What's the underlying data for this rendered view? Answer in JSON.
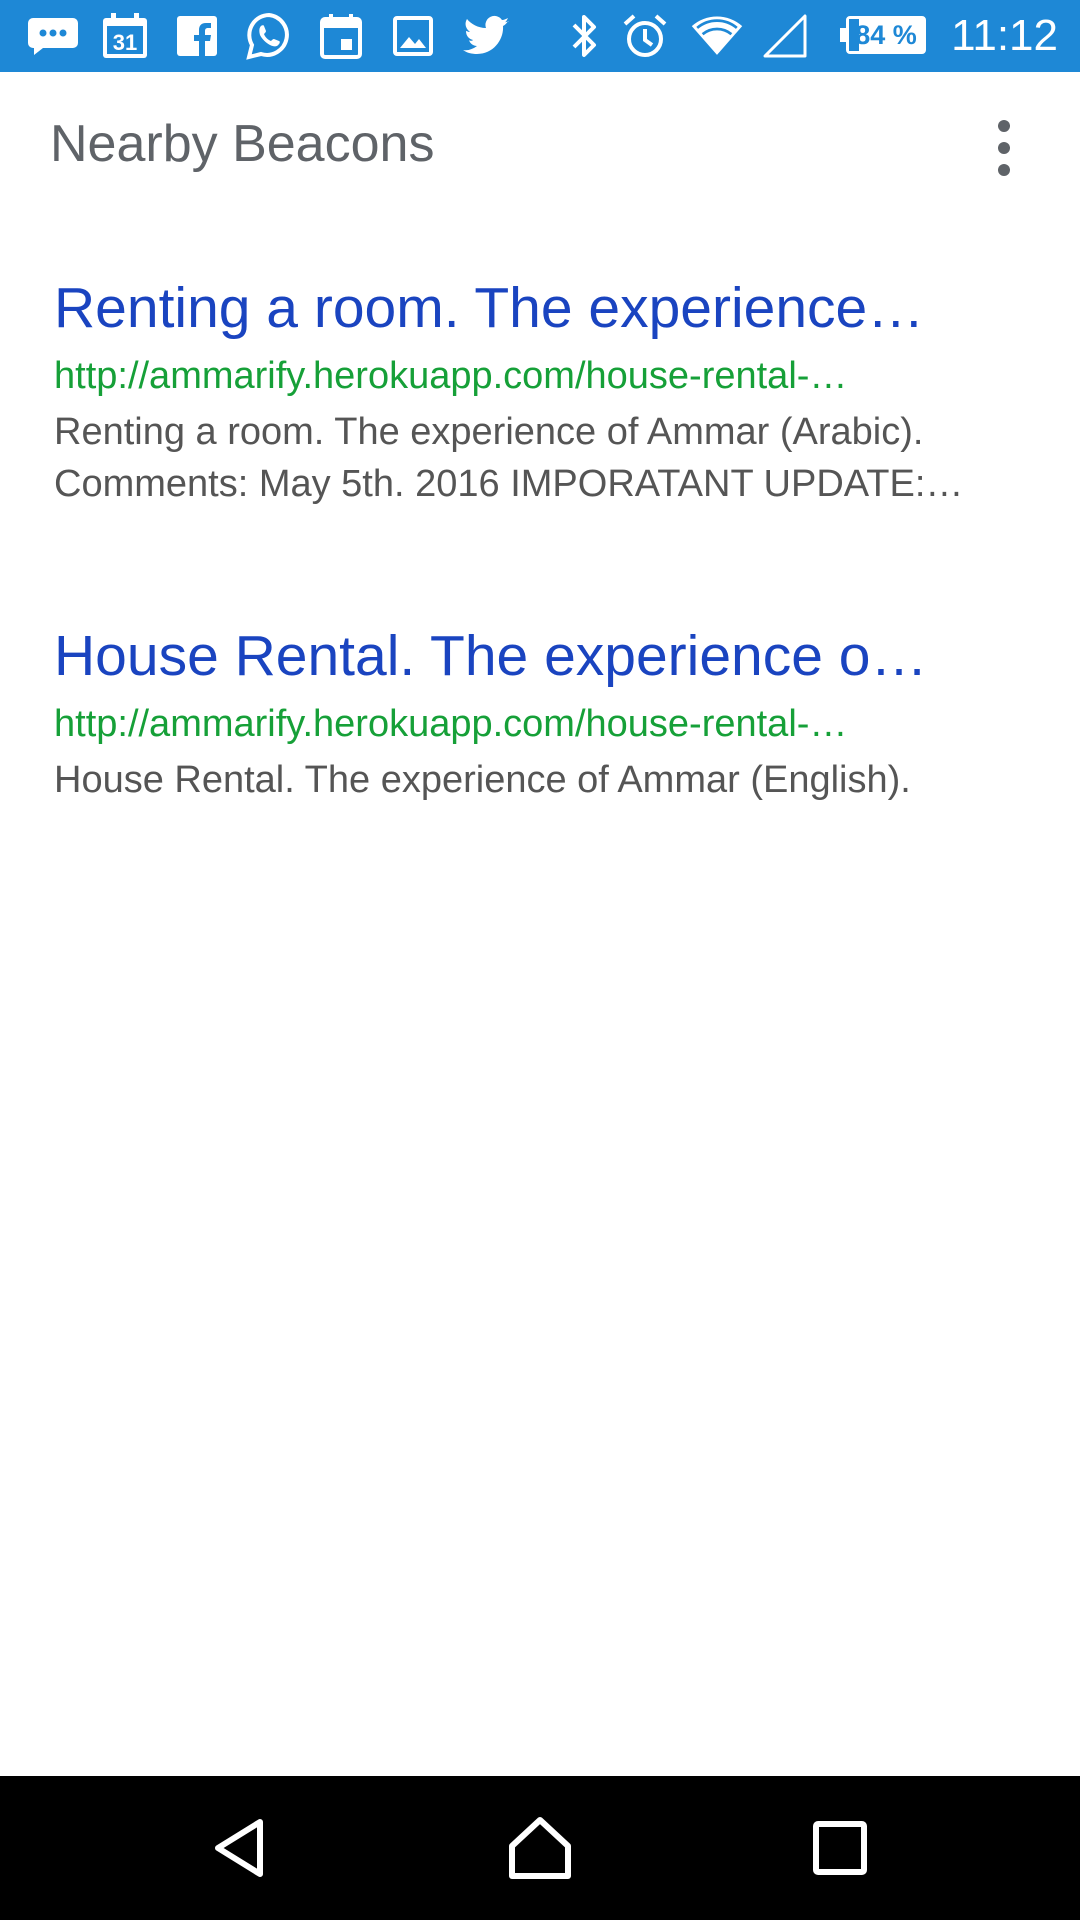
{
  "status_bar": {
    "notification_icons": [
      "chat-bubble-icon",
      "calendar-31-icon",
      "facebook-icon",
      "whatsapp-icon",
      "calendar-icon",
      "image-icon",
      "twitter-icon"
    ],
    "calendar_day": "31",
    "system_icons": [
      "bluetooth-icon",
      "alarm-icon",
      "wifi-icon",
      "cell-signal-icon"
    ],
    "battery": "84 %",
    "battery_level_percent": 84,
    "time": "11:12",
    "background_color": "#1e88d6"
  },
  "app_bar": {
    "title": "Nearby Beacons",
    "menu_icon": "more-vert-icon"
  },
  "results": [
    {
      "title": "Renting a room. The experience…",
      "url": "http://ammarify.herokuapp.com/house-rental-…",
      "description": "Renting a room. The experience of Ammar (Arabic). Comments: May 5th. 2016 IMPORATANT UPDATE:…"
    },
    {
      "title": "House Rental. The experience o…",
      "url": "http://ammarify.herokuapp.com/house-rental-…",
      "description": "House Rental. The experience of Ammar (English)."
    }
  ],
  "colors": {
    "title_link": "#1a44c0",
    "url": "#16a038",
    "description": "#555555"
  },
  "nav_bar": {
    "buttons": [
      "back-icon",
      "home-icon",
      "recents-icon"
    ]
  }
}
